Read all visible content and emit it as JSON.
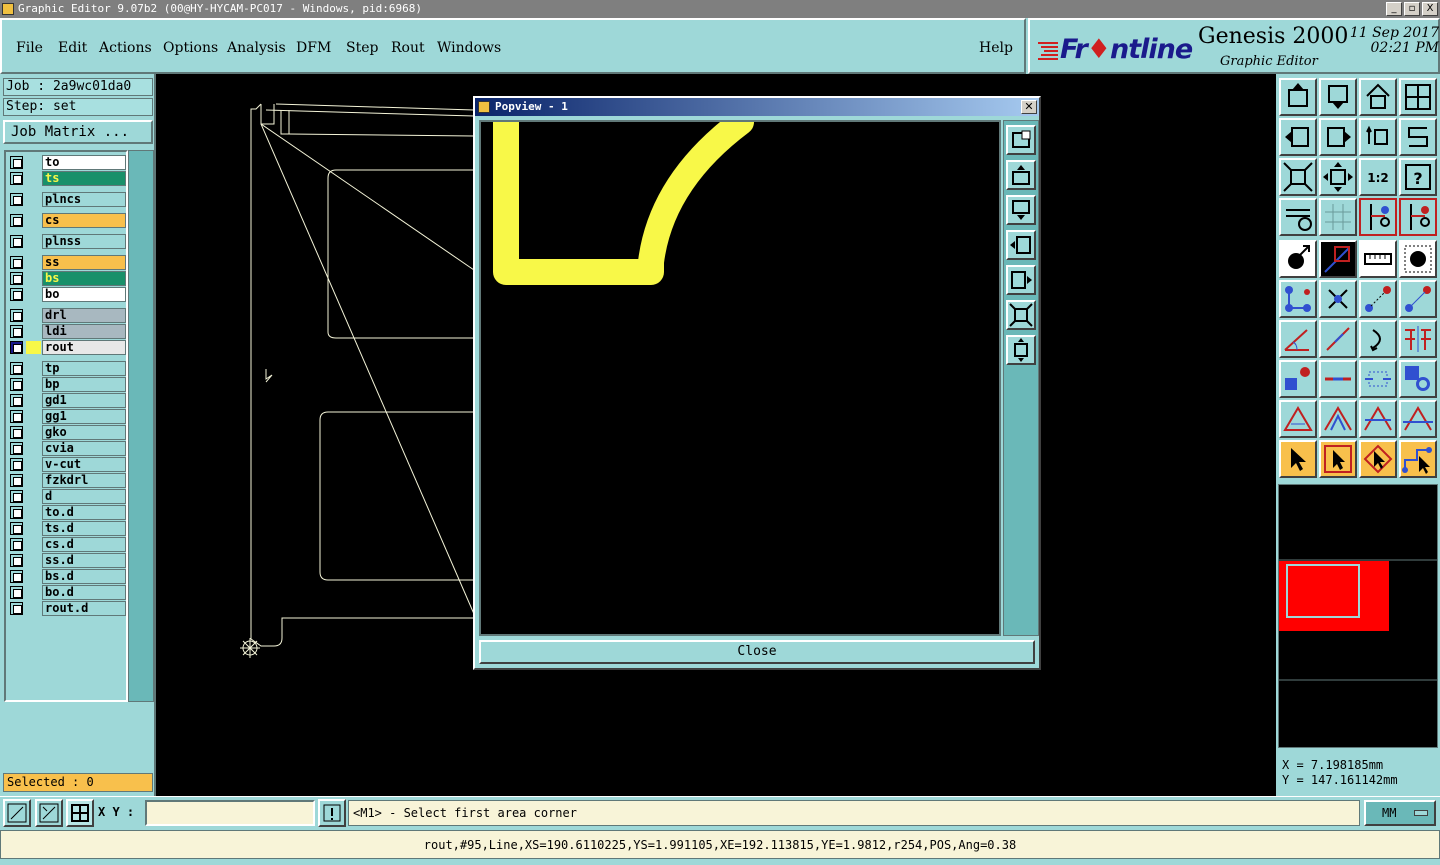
{
  "window": {
    "title": "Graphic Editor 9.07b2 (00@HY-HYCAM-PC017 - Windows, pid:6968)",
    "controls": [
      "_",
      "▫",
      "X"
    ]
  },
  "menu": {
    "items": [
      "File",
      "Edit",
      "Actions",
      "Options",
      "Analysis",
      "DFM",
      "Step",
      "Rout",
      "Windows"
    ],
    "help": "Help"
  },
  "brand": {
    "logo_prefix": "Fr",
    "logo_suffix": "ntline",
    "product": "Genesis 2000",
    "subtitle": "Graphic Editor",
    "date": "11 Sep 2017",
    "time": "02:21 PM"
  },
  "job": {
    "job_label": "Job : 2a9wc01da0",
    "step_label": "Step: set",
    "matrix_button": "Job Matrix ..."
  },
  "layers": [
    {
      "name": "to",
      "color": "#ffffff"
    },
    {
      "name": "ts",
      "color": "#18906a"
    },
    {
      "name": "plncs",
      "color": "#9ed8d8"
    },
    {
      "name": "cs",
      "color": "#f8c04c"
    },
    {
      "name": "plnss",
      "color": "#9ed8d8"
    },
    {
      "name": "ss",
      "color": "#f8c04c"
    },
    {
      "name": "bs",
      "color": "#18906a"
    },
    {
      "name": "bo",
      "color": "#ffffff"
    },
    {
      "name": "drl",
      "color": "#a8b8c0"
    },
    {
      "name": "ldi",
      "color": "#a8b8c0"
    },
    {
      "name": "rout",
      "color": "#e8e8e8",
      "active": true
    },
    {
      "name": "tp",
      "color": "#9ed8d8"
    },
    {
      "name": "bp",
      "color": "#9ed8d8"
    },
    {
      "name": "gd1",
      "color": "#9ed8d8"
    },
    {
      "name": "gg1",
      "color": "#9ed8d8"
    },
    {
      "name": "gko",
      "color": "#9ed8d8"
    },
    {
      "name": "cvia",
      "color": "#9ed8d8"
    },
    {
      "name": "v-cut",
      "color": "#9ed8d8"
    },
    {
      "name": "fzkdrl",
      "color": "#9ed8d8"
    },
    {
      "name": "d",
      "color": "#9ed8d8"
    },
    {
      "name": "to.d",
      "color": "#9ed8d8"
    },
    {
      "name": "ts.d",
      "color": "#9ed8d8"
    },
    {
      "name": "cs.d",
      "color": "#9ed8d8"
    },
    {
      "name": "ss.d",
      "color": "#9ed8d8"
    },
    {
      "name": "bs.d",
      "color": "#9ed8d8"
    },
    {
      "name": "bo.d",
      "color": "#9ed8d8"
    },
    {
      "name": "rout.d",
      "color": "#9ed8d8"
    }
  ],
  "selected": "Selected : 0",
  "popview": {
    "title": "Popview - 1",
    "close_label": "Close",
    "feature_color": "#f8f848"
  },
  "coords": {
    "x": "X = 7.198185mm",
    "y": "Y = 147.161142mm"
  },
  "command": {
    "xy_label": "X Y :",
    "xy_value": "",
    "prompt": "<M1> - Select first area corner",
    "units": "MM"
  },
  "status": "rout,#95,Line,XS=190.6110225,YS=1.991105,XE=192.113815,YE=1.9812,r254,POS,Ang=0.38",
  "colors": {
    "panel": "#9ed8d8",
    "canvas": "#000000",
    "thumb_board": "#ff0000"
  }
}
